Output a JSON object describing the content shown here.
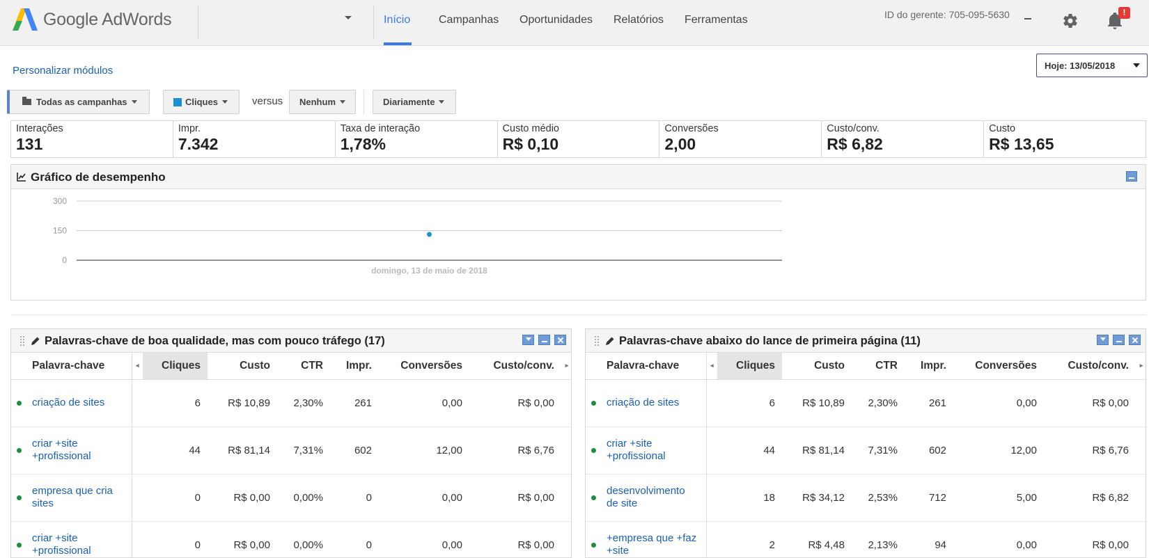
{
  "header": {
    "brand": "Google AdWords",
    "nav": [
      "Início",
      "Campanhas",
      "Oportunidades",
      "Relatórios",
      "Ferramentas"
    ],
    "active_nav": "Início",
    "manager_id": "ID do gerente: 705-095-5630",
    "notification_badge": "!"
  },
  "toolbar": {
    "personalize_link": "Personalizar módulos",
    "date_button": "Hoje: 13/05/2018",
    "campaigns_button": "Todas as campanhas",
    "metric_button": "Cliques",
    "versus_label": "versus",
    "compare_button": "Nenhum",
    "period_button": "Diariamente"
  },
  "metrics": [
    {
      "label": "Interações",
      "value": "131"
    },
    {
      "label": "Impr.",
      "value": "7.342"
    },
    {
      "label": "Taxa de interação",
      "value": "1,78%"
    },
    {
      "label": "Custo médio",
      "value": "R$ 0,10"
    },
    {
      "label": "Conversões",
      "value": "2,00"
    },
    {
      "label": "Custo/conv.",
      "value": "R$ 6,82"
    },
    {
      "label": "Custo",
      "value": "R$ 13,65"
    }
  ],
  "performance": {
    "title": "Gráfico de desempenho"
  },
  "chart_data": {
    "type": "scatter",
    "title": "",
    "x": [
      "domingo, 13 de maio de 2018"
    ],
    "series": [
      {
        "values": [
          131
        ]
      }
    ],
    "yticks": [
      0,
      150,
      300
    ],
    "ylim": [
      0,
      300
    ],
    "xlabel": "",
    "ylabel": "",
    "grid": true,
    "color": "#1a8fd1"
  },
  "columns": [
    "Palavra-chave",
    "Cliques",
    "Custo",
    "CTR",
    "Impr.",
    "Conversões",
    "Custo/conv."
  ],
  "left_panel": {
    "title": "Palavras-chave de boa qualidade, mas com pouco tráfego (17)",
    "rows": [
      {
        "kw": "criação de sites",
        "clicks": "6",
        "cost": "R$ 10,89",
        "ctr": "2,30%",
        "impr": "261",
        "conv": "0,00",
        "cpc": "R$ 0,00"
      },
      {
        "kw": "criar +site +profissional",
        "clicks": "44",
        "cost": "R$ 81,14",
        "ctr": "7,31%",
        "impr": "602",
        "conv": "12,00",
        "cpc": "R$ 6,76"
      },
      {
        "kw": "empresa que cria sites",
        "clicks": "0",
        "cost": "R$ 0,00",
        "ctr": "0,00%",
        "impr": "0",
        "conv": "0,00",
        "cpc": "R$ 0,00"
      },
      {
        "kw": "criar +site +profissional",
        "clicks": "0",
        "cost": "R$ 0,00",
        "ctr": "0,00%",
        "impr": "0",
        "conv": "0,00",
        "cpc": "R$ 0,00"
      }
    ]
  },
  "right_panel": {
    "title": "Palavras-chave abaixo do lance de primeira página (11)",
    "rows": [
      {
        "kw": "criação de sites",
        "clicks": "6",
        "cost": "R$ 10,89",
        "ctr": "2,30%",
        "impr": "261",
        "conv": "0,00",
        "cpc": "R$ 0,00"
      },
      {
        "kw": "criar +site +profissional",
        "clicks": "44",
        "cost": "R$ 81,14",
        "ctr": "7,31%",
        "impr": "602",
        "conv": "12,00",
        "cpc": "R$ 6,76"
      },
      {
        "kw": "desenvolvimento de site",
        "clicks": "18",
        "cost": "R$ 34,12",
        "ctr": "2,53%",
        "impr": "712",
        "conv": "5,00",
        "cpc": "R$ 6,82"
      },
      {
        "kw": "+empresa que +faz +site",
        "clicks": "2",
        "cost": "R$ 4,48",
        "ctr": "2,13%",
        "impr": "94",
        "conv": "0,00",
        "cpc": "R$ 0,00"
      }
    ]
  }
}
